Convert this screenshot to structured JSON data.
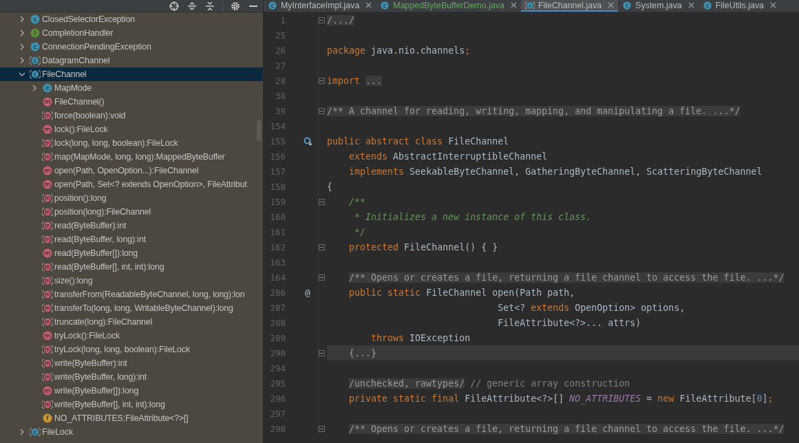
{
  "structure_panel": {
    "toolbar": [
      {
        "kind": "locate"
      },
      {
        "kind": "expand-all"
      },
      {
        "kind": "collapse-all"
      },
      {
        "kind": "separator"
      },
      {
        "kind": "settings"
      },
      {
        "kind": "minimize"
      }
    ],
    "tree": [
      {
        "label": "ClosedSelectorException",
        "kind": "class",
        "glyph": "c",
        "expanded": false,
        "selected": false
      },
      {
        "label": "CompletionHandler",
        "kind": "interface",
        "glyph": "I",
        "expanded": false,
        "selected": false
      },
      {
        "label": "ConnectionPendingException",
        "kind": "class",
        "glyph": "c",
        "expanded": false,
        "selected": false
      },
      {
        "label": "DatagramChannel",
        "kind": "abstract-class",
        "glyph": "c",
        "expanded": false,
        "selected": false
      },
      {
        "label": "FileChannel",
        "kind": "abstract-class",
        "glyph": "c",
        "expanded": true,
        "selected": true,
        "children": [
          {
            "label": "MapMode",
            "kind": "class",
            "glyph": "c",
            "expanded": false,
            "selected": false
          },
          {
            "label": "FileChannel()",
            "kind": "method",
            "glyph": "m",
            "selected": false
          },
          {
            "label": "force(boolean):void",
            "kind": "abstract-method",
            "glyph": "m",
            "selected": false
          },
          {
            "label": "lock():FileLock",
            "kind": "method",
            "glyph": "m",
            "selected": false
          },
          {
            "label": "lock(long, long, boolean):FileLock",
            "kind": "abstract-method",
            "glyph": "m",
            "selected": false
          },
          {
            "label": "map(MapMode, long, long):MappedByteBuffer",
            "kind": "abstract-method",
            "glyph": "m",
            "selected": false
          },
          {
            "label": "open(Path, OpenOption...):FileChannel",
            "kind": "method",
            "glyph": "m",
            "selected": false
          },
          {
            "label": "open(Path, Set<? extends OpenOption>, FileAttribut",
            "kind": "method",
            "glyph": "m",
            "selected": false
          },
          {
            "label": "position():long",
            "kind": "abstract-method",
            "glyph": "m",
            "selected": false
          },
          {
            "label": "position(long):FileChannel",
            "kind": "abstract-method",
            "glyph": "m",
            "selected": false
          },
          {
            "label": "read(ByteBuffer):int",
            "kind": "abstract-method",
            "glyph": "m",
            "selected": false
          },
          {
            "label": "read(ByteBuffer, long):int",
            "kind": "abstract-method",
            "glyph": "m",
            "selected": false
          },
          {
            "label": "read(ByteBuffer[]):long",
            "kind": "method",
            "glyph": "m",
            "selected": false
          },
          {
            "label": "read(ByteBuffer[], int, int):long",
            "kind": "abstract-method",
            "glyph": "m",
            "selected": false
          },
          {
            "label": "size():long",
            "kind": "abstract-method",
            "glyph": "m",
            "selected": false
          },
          {
            "label": "transferFrom(ReadableByteChannel, long, long):lon",
            "kind": "abstract-method",
            "glyph": "m",
            "selected": false
          },
          {
            "label": "transferTo(long, long, WritableByteChannel):long",
            "kind": "abstract-method",
            "glyph": "m",
            "selected": false
          },
          {
            "label": "truncate(long):FileChannel",
            "kind": "abstract-method",
            "glyph": "m",
            "selected": false
          },
          {
            "label": "tryLock():FileLock",
            "kind": "method",
            "glyph": "m",
            "selected": false
          },
          {
            "label": "tryLock(long, long, boolean):FileLock",
            "kind": "abstract-method",
            "glyph": "m",
            "selected": false
          },
          {
            "label": "write(ByteBuffer):int",
            "kind": "abstract-method",
            "glyph": "m",
            "selected": false
          },
          {
            "label": "write(ByteBuffer, long):int",
            "kind": "abstract-method",
            "glyph": "m",
            "selected": false
          },
          {
            "label": "write(ByteBuffer[]):long",
            "kind": "method",
            "glyph": "m",
            "selected": false
          },
          {
            "label": "write(ByteBuffer[], int, int):long",
            "kind": "abstract-method",
            "glyph": "m",
            "selected": false
          },
          {
            "label": "NO_ATTRIBUTES:FileAttribute<?>[]",
            "kind": "field",
            "glyph": "f",
            "selected": false
          }
        ]
      },
      {
        "label": "FileLock",
        "kind": "abstract-class",
        "glyph": "c",
        "expanded": false,
        "selected": false
      }
    ]
  },
  "editor": {
    "tabs": [
      {
        "title": "MyInterfaceImpl.java",
        "glyph": "c",
        "kind": "class",
        "added": false,
        "selected": false
      },
      {
        "title": "MappedByteBufferDemo.java",
        "glyph": "c",
        "kind": "class",
        "added": true,
        "selected": false
      },
      {
        "title": "FileChannel.java",
        "glyph": "c",
        "kind": "abstract-class",
        "added": false,
        "selected": true
      },
      {
        "title": "System.java",
        "glyph": "c",
        "kind": "class",
        "added": false,
        "selected": false
      },
      {
        "title": "FileUtils.java",
        "glyph": "c",
        "kind": "class",
        "added": false,
        "selected": false
      }
    ],
    "lines": [
      {
        "number": "1",
        "fold": true,
        "current": false,
        "tokens": [
          {
            "kind": "folded",
            "text": "/.../"
          }
        ]
      },
      {
        "number": "25",
        "fold": false,
        "current": false
      },
      {
        "number": "26",
        "fold": false,
        "current": false,
        "tokens": [
          {
            "kind": "keyword",
            "text": "package"
          },
          {
            "kind": "plain",
            "text": " java.nio.channels"
          },
          {
            "kind": "keyword",
            "text": ";"
          }
        ]
      },
      {
        "number": "27",
        "fold": false,
        "current": false
      },
      {
        "number": "28",
        "fold": true,
        "current": false,
        "tokens": [
          {
            "kind": "keyword",
            "text": "import "
          },
          {
            "kind": "folded",
            "text": "..."
          }
        ]
      },
      {
        "number": "38",
        "fold": false,
        "current": false
      },
      {
        "number": "39",
        "fold": true,
        "current": false,
        "tokens": [
          {
            "kind": "folded",
            "text": "/** A channel for reading, writing, mapping, and manipulating a file. ...*/"
          }
        ]
      },
      {
        "number": "154",
        "fold": false,
        "current": false
      },
      {
        "number": "155",
        "fold": false,
        "current": false,
        "kind": "implemented",
        "tokens": [
          {
            "kind": "keyword",
            "text": "public abstract class"
          },
          {
            "kind": "plain",
            "text": " FileChannel"
          }
        ]
      },
      {
        "number": "156",
        "fold": false,
        "current": false,
        "tokens": [
          {
            "kind": "keyword",
            "text": "    extends"
          },
          {
            "kind": "plain",
            "text": " AbstractInterruptibleChannel"
          }
        ]
      },
      {
        "number": "157",
        "fold": false,
        "current": false,
        "tokens": [
          {
            "kind": "keyword",
            "text": "    implements"
          },
          {
            "kind": "plain",
            "text": " SeekableByteChannel, GatheringByteChannel, ScatteringByteChannel"
          }
        ]
      },
      {
        "number": "158",
        "fold": false,
        "current": false,
        "tokens": [
          {
            "kind": "plain",
            "text": "{"
          }
        ]
      },
      {
        "number": "159",
        "fold": true,
        "current": false,
        "tokens": [
          {
            "kind": "doc",
            "text": "    /**"
          }
        ]
      },
      {
        "number": "160",
        "fold": false,
        "current": false,
        "tokens": [
          {
            "kind": "doc",
            "text": "     * Initializes a new instance of this class."
          }
        ]
      },
      {
        "number": "161",
        "fold": false,
        "current": false,
        "tokens": [
          {
            "kind": "doc",
            "text": "     */"
          }
        ]
      },
      {
        "number": "162",
        "fold": true,
        "current": false,
        "tokens": [
          {
            "kind": "keyword",
            "text": "    protected"
          },
          {
            "kind": "plain",
            "text": " FileChannel() { }"
          }
        ]
      },
      {
        "number": "163",
        "fold": false,
        "current": false
      },
      {
        "number": "164",
        "fold": true,
        "current": false,
        "tokens": [
          {
            "kind": "folded",
            "text": "    /** Opens or creates a file, returning a file channel to access the file. ...*/"
          }
        ]
      },
      {
        "number": "286",
        "fold": false,
        "current": false,
        "marker": "@",
        "tokens": [
          {
            "kind": "keyword",
            "text": "    public static"
          },
          {
            "kind": "plain",
            "text": " FileChannel open(Path path,"
          }
        ]
      },
      {
        "number": "287",
        "fold": false,
        "current": false,
        "tokens": [
          {
            "kind": "plain",
            "text": "                               Set<? "
          },
          {
            "kind": "keyword",
            "text": "extends"
          },
          {
            "kind": "plain",
            "text": " OpenOption> options,"
          }
        ]
      },
      {
        "number": "288",
        "fold": false,
        "current": false,
        "tokens": [
          {
            "kind": "plain",
            "text": "                               FileAttribute<?>... attrs)"
          }
        ]
      },
      {
        "number": "289",
        "fold": false,
        "current": false,
        "tokens": [
          {
            "kind": "keyword",
            "text": "        throws"
          },
          {
            "kind": "plain",
            "text": " IOException"
          }
        ]
      },
      {
        "number": "290",
        "fold": true,
        "current": true,
        "tokens": [
          {
            "kind": "folded",
            "text": "    {...}"
          }
        ]
      },
      {
        "number": "294",
        "fold": false,
        "current": false
      },
      {
        "number": "295",
        "fold": false,
        "current": false,
        "tokens": [
          {
            "kind": "folded",
            "text": "    /unchecked, rawtypes/"
          },
          {
            "kind": "comment",
            "text": " // generic array construction"
          }
        ]
      },
      {
        "number": "296",
        "fold": false,
        "current": false,
        "tokens": [
          {
            "kind": "keyword",
            "text": "    private static final"
          },
          {
            "kind": "plain",
            "text": " FileAttribute<?>[] "
          },
          {
            "kind": "field",
            "text": "NO_ATTRIBUTES"
          },
          {
            "kind": "plain",
            "text": " = "
          },
          {
            "kind": "keyword",
            "text": "new"
          },
          {
            "kind": "plain",
            "text": " FileAttribute["
          },
          {
            "kind": "number",
            "text": "0"
          },
          {
            "kind": "plain",
            "text": "]"
          },
          {
            "kind": "keyword",
            "text": ";"
          }
        ]
      },
      {
        "number": "297",
        "fold": false,
        "current": false
      },
      {
        "number": "298",
        "fold": true,
        "current": false,
        "tokens": [
          {
            "kind": "folded",
            "text": "    /** Opens or creates a file, returning a file channel to access the file. ...*/"
          }
        ]
      }
    ]
  }
}
